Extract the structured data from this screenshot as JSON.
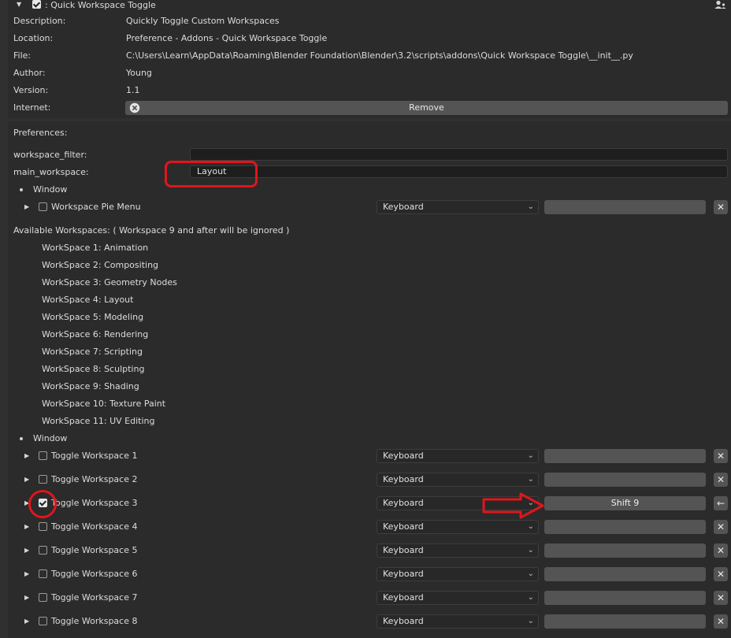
{
  "addon": {
    "name": ": Quick Workspace Toggle",
    "details": [
      {
        "label": "Description:",
        "value": "Quickly Toggle Custom Workspaces"
      },
      {
        "label": "Location:",
        "value": "Preference - Addons - Quick Workspace Toggle"
      },
      {
        "label": "File:",
        "value": "C:\\Users\\Learn\\AppData\\Roaming\\Blender Foundation\\Blender\\3.2\\scripts\\addons\\Quick Workspace Toggle\\__init__.py"
      },
      {
        "label": "Author:",
        "value": "Young"
      },
      {
        "label": "Version:",
        "value": "1.1"
      }
    ],
    "internet_label": "Internet:",
    "remove_label": "Remove"
  },
  "preferences": {
    "title": "Preferences:",
    "workspace_filter_label": "workspace_filter:",
    "workspace_filter_value": "",
    "main_workspace_label": "main_workspace:",
    "main_workspace_value": "Layout",
    "window_label_1": "Window",
    "pie_menu": {
      "name": "Workspace Pie Menu",
      "type": "Keyboard",
      "key": "",
      "x": "✕"
    },
    "available_title": "Available Workspaces: ( Workspace 9 and after will be ignored )",
    "workspaces": [
      "WorkSpace 1:  Animation",
      "WorkSpace 2:  Compositing",
      "WorkSpace 3:  Geometry Nodes",
      "WorkSpace 4:  Layout",
      "WorkSpace 5:  Modeling",
      "WorkSpace 6:  Rendering",
      "WorkSpace 7:  Scripting",
      "WorkSpace 8:  Sculpting",
      "WorkSpace 9:  Shading",
      "WorkSpace 10:  Texture Paint",
      "WorkSpace 11:  UV Editing"
    ],
    "window_label_2": "Window",
    "toggles": [
      {
        "name": "Toggle Workspace 1",
        "type": "Keyboard",
        "key": "",
        "action": "✕",
        "checked": false
      },
      {
        "name": "Toggle Workspace 2",
        "type": "Keyboard",
        "key": "",
        "action": "✕",
        "checked": false
      },
      {
        "name": "Toggle Workspace 3",
        "type": "Keyboard",
        "key": "Shift 9",
        "action": "←",
        "checked": true
      },
      {
        "name": "Toggle Workspace 4",
        "type": "Keyboard",
        "key": "",
        "action": "✕",
        "checked": false
      },
      {
        "name": "Toggle Workspace 5",
        "type": "Keyboard",
        "key": "",
        "action": "✕",
        "checked": false
      },
      {
        "name": "Toggle Workspace 6",
        "type": "Keyboard",
        "key": "",
        "action": "✕",
        "checked": false
      },
      {
        "name": "Toggle Workspace 7",
        "type": "Keyboard",
        "key": "",
        "action": "✕",
        "checked": false
      },
      {
        "name": "Toggle Workspace 8",
        "type": "Keyboard",
        "key": "",
        "action": "✕",
        "checked": false
      }
    ]
  },
  "icons": {
    "collapse": "triangle-down-icon",
    "expand": "triangle-right-icon",
    "user": "user-icon",
    "remove": "remove-circle-icon",
    "chevron": "chevron-down-icon",
    "annotation_arrow": "red-arrow-annotation"
  },
  "colors": {
    "background": "#303030",
    "panel": "#2b2b2b",
    "field": "#1e1e1e",
    "button": "#545454",
    "annotation": "#e0161b"
  }
}
